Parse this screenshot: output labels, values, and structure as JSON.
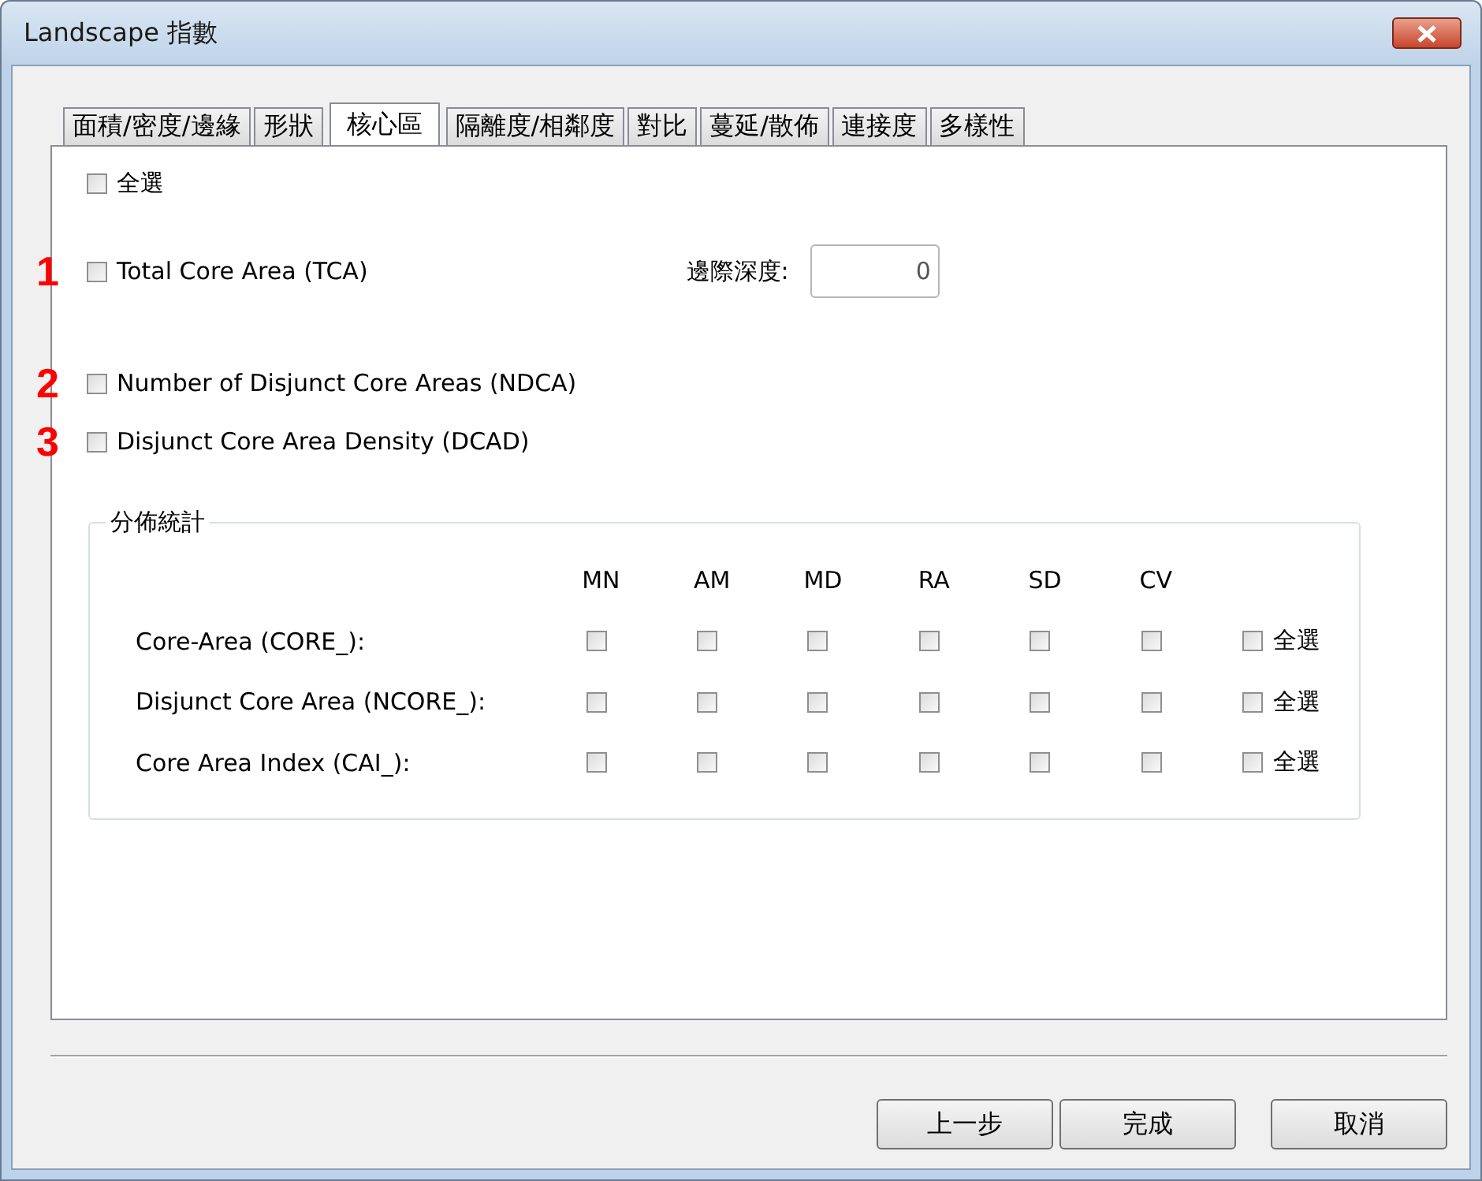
{
  "window": {
    "title": "Landscape 指數"
  },
  "tabs": [
    {
      "label": "面積/密度/邊緣",
      "selected": false
    },
    {
      "label": "形狀",
      "selected": false
    },
    {
      "label": "核心區",
      "selected": true
    },
    {
      "label": "隔離度/相鄰度",
      "selected": false
    },
    {
      "label": "對比",
      "selected": false
    },
    {
      "label": "蔓延/散佈",
      "selected": false
    },
    {
      "label": "連接度",
      "selected": false
    },
    {
      "label": "多樣性",
      "selected": false
    }
  ],
  "select_all": {
    "label": "全選",
    "checked": false
  },
  "metrics": [
    {
      "marker": "1",
      "label": "Total Core Area (TCA)",
      "checked": false,
      "field": {
        "label": "邊際深度:",
        "value": "0"
      }
    },
    {
      "marker": "2",
      "label": "Number of Disjunct Core Areas (NDCA)",
      "checked": false
    },
    {
      "marker": "3",
      "label": "Disjunct Core Area Density (DCAD)",
      "checked": false
    }
  ],
  "distribution": {
    "title": "分佈統計",
    "columns": [
      "MN",
      "AM",
      "MD",
      "RA",
      "SD",
      "CV"
    ],
    "rows": [
      {
        "label": "Core-Area (CORE_):",
        "checks": [
          false,
          false,
          false,
          false,
          false,
          false
        ],
        "select_all": {
          "label": "全選",
          "checked": false
        }
      },
      {
        "label": "Disjunct Core Area (NCORE_):",
        "checks": [
          false,
          false,
          false,
          false,
          false,
          false
        ],
        "select_all": {
          "label": "全選",
          "checked": false
        }
      },
      {
        "label": "Core Area Index (CAI_):",
        "checks": [
          false,
          false,
          false,
          false,
          false,
          false
        ],
        "select_all": {
          "label": "全選",
          "checked": false
        }
      }
    ]
  },
  "buttons": [
    {
      "label": "上一步"
    },
    {
      "label": "完成"
    },
    {
      "label": "取消"
    }
  ]
}
